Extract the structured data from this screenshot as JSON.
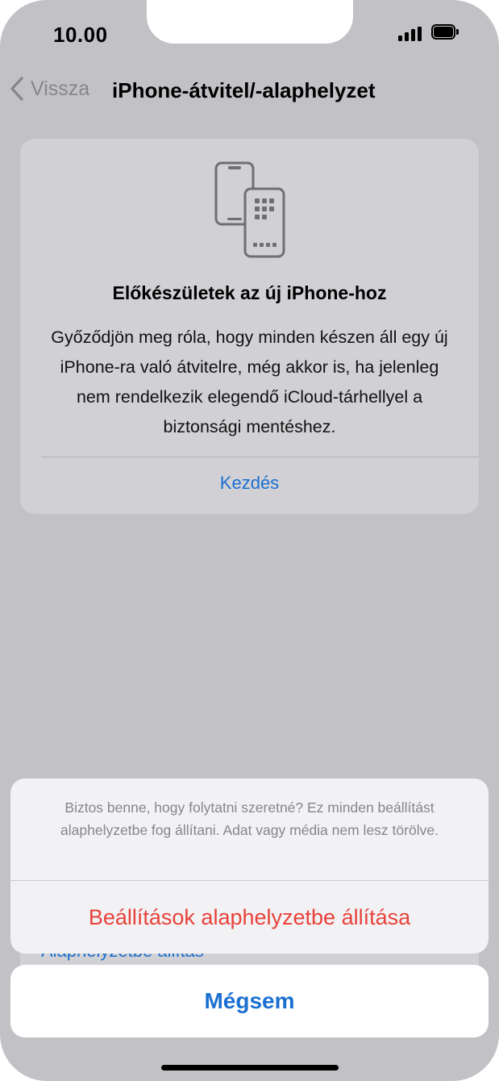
{
  "status_bar": {
    "time": "10.00"
  },
  "nav": {
    "back_label": "Vissza",
    "title": "iPhone-átvitel/-alaphelyzet"
  },
  "card": {
    "icon": "iphone-transfer-icon",
    "title": "Előkészületek az új iPhone-hoz",
    "description": "Győződjön meg róla, hogy minden készen áll egy új iPhone-ra való átvitelre, még akkor is, ha jelenleg nem rendelkezik elegendő iCloud-tárhellyel a biztonsági mentéshez.",
    "action_label": "Kezdés"
  },
  "background_item": {
    "label": "Alaphelyzetbe állítás"
  },
  "action_sheet": {
    "message": "Biztos benne, hogy folytatni szeretné? Ez minden beállítást alaphelyzetbe fog állítani. Adat vagy média nem lesz törölve.",
    "destructive_label": "Beállítások alaphelyzetbe állítása",
    "cancel_label": "Mégsem"
  },
  "colors": {
    "accent": "#1a6fd0",
    "destructive": "#e8413a",
    "dimmed_background": "#c2c2c6"
  }
}
